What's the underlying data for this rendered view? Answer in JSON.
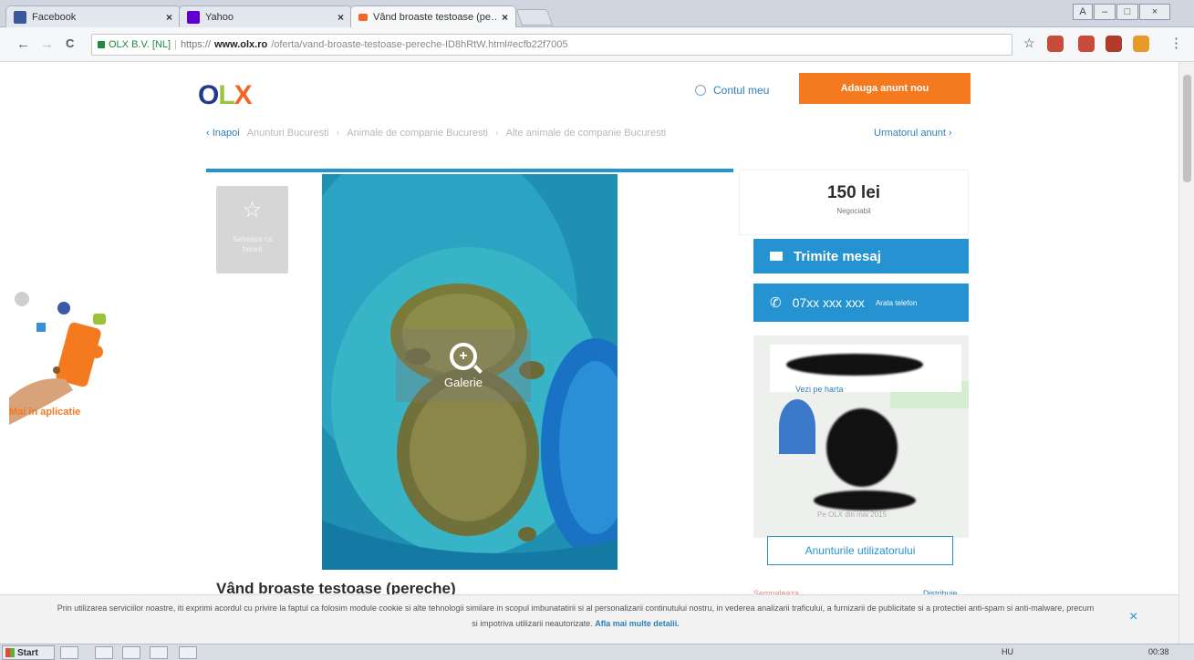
{
  "browser": {
    "tabs": [
      {
        "label": "Facebook",
        "close": "×",
        "active": false
      },
      {
        "label": "Yahoo",
        "close": "×",
        "active": false
      },
      {
        "label": "Vând broaste testoase (pe…",
        "close": "×",
        "active": true
      }
    ],
    "window_controls": [
      "A",
      "–",
      "□",
      "×"
    ],
    "nav": {
      "back": "←",
      "forward": "→",
      "reload": "C"
    },
    "address": {
      "secure_label": "OLX B.V. [NL]",
      "protocol": "https://",
      "host": "www.olx.ro",
      "path": "/oferta/vand-broaste-testoase-pereche-ID8hRtW.html#ecfb22f7005"
    },
    "bookmark_star": "☆",
    "menu": "⋮"
  },
  "header": {
    "logo": {
      "o": "O",
      "l": "L",
      "x": "X"
    },
    "account_label": "Contul meu",
    "post_button": "Adauga anunt nou"
  },
  "breadcrumbs": {
    "back": "‹ Inapoi",
    "items": [
      "Anunturi Bucuresti",
      "Animale de companie Bucuresti",
      "Alte animale de companie Bucuresti"
    ],
    "separator": "›",
    "next": "Urmatorul anunt ›"
  },
  "listing": {
    "favorite_label": "Salveaza ca favorit",
    "gallery_label": "Galerie",
    "title": "Vând broaste testoase (pereche)",
    "price": "150 lei",
    "negotiable": "Negociabil",
    "send_message": "Trimite mesaj",
    "phone_number": "07xx xxx xxx",
    "phone_show": "Arata telefon",
    "map_link": "Vezi pe harta",
    "member_since": "Pe OLX din mai 2015",
    "user_ads": "Anunturile utilizatorului",
    "report": "Semnaleaza",
    "share": "Distribuie"
  },
  "promo": {
    "label": "Mai in aplicatie"
  },
  "cookie": {
    "text": "Prin utilizarea serviciilor noastre, iti exprimi acordul cu privire la faptul ca folosim module cookie si alte tehnologii similare in scopul imbunatatirii si al personalizarii continutului nostru, in vederea analizarii traficului, a furnizarii de publicitate si a protectiei anti-spam si anti-malware, precum si impotriva utilizarii neautorizate.",
    "more": "Afla mai multe detalii.",
    "close": "×"
  },
  "taskbar": {
    "start": "Start",
    "tray": [
      "HU",
      "00:38"
    ]
  },
  "colors": {
    "olx_blue": "#23398e",
    "olx_green": "#9ac33b",
    "olx_orange": "#f26522",
    "accent_blue": "#2593d1",
    "post_orange": "#f4791f"
  }
}
